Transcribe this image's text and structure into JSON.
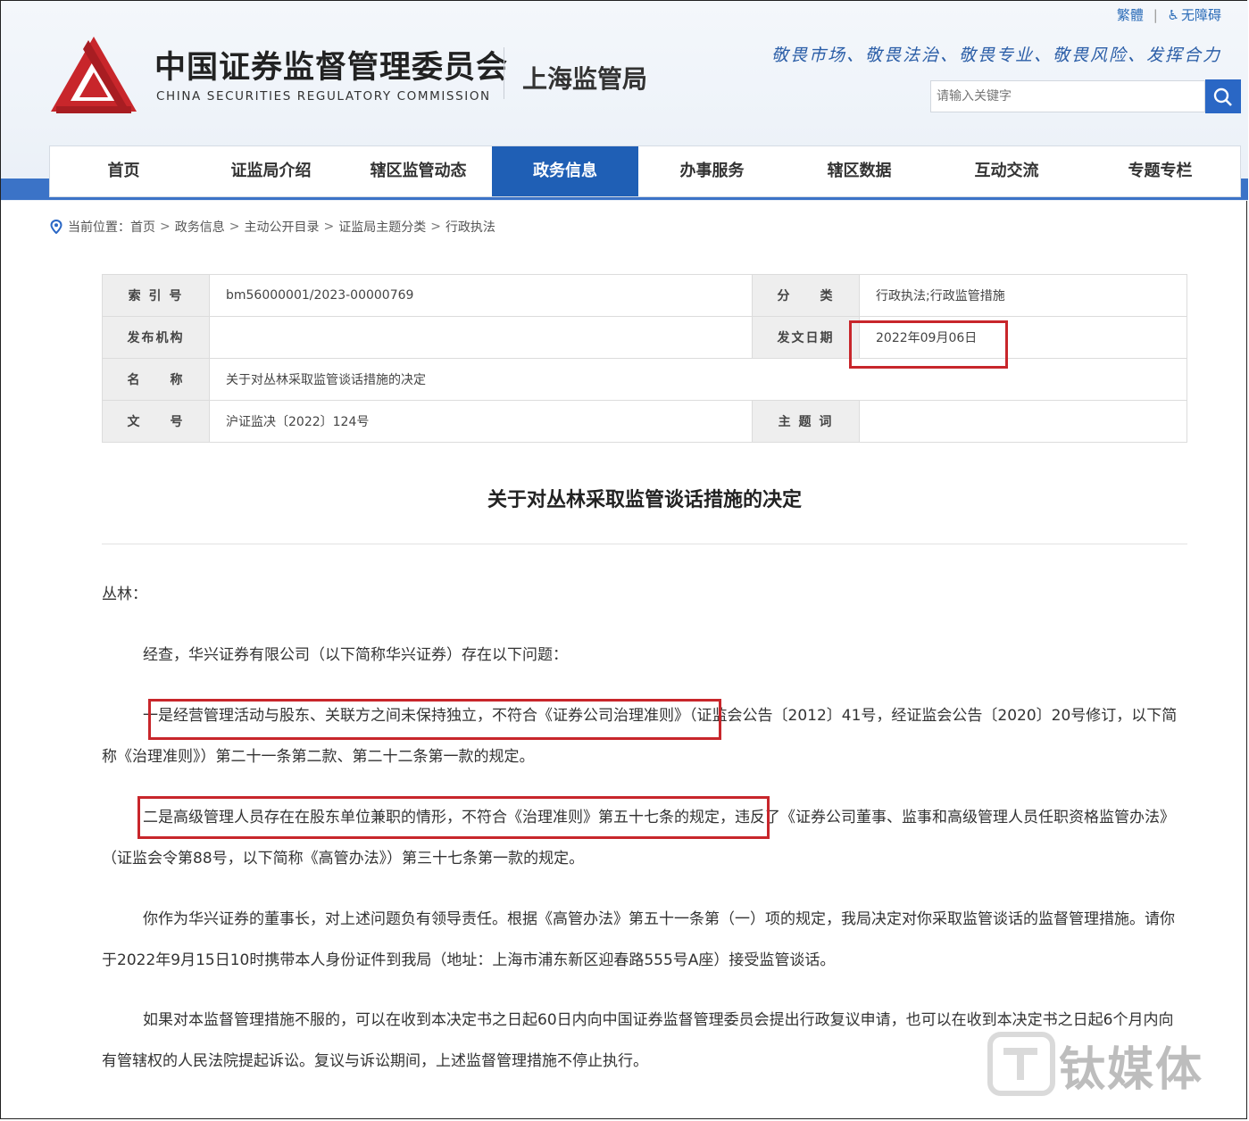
{
  "header": {
    "top_links": [
      "繁體",
      "|",
      "无障碍"
    ],
    "org_cn": "中国证券监督管理委员会",
    "org_en": "CHINA SECURITIES REGULATORY COMMISSION",
    "bureau": "上海监管局",
    "motto": "敬畏市场、敬畏法治、敬畏专业、敬畏风险、发挥合力",
    "search_placeholder": "请输入关键字",
    "brand_color": "#c8262b",
    "accent_color": "#1f5fb5"
  },
  "nav": {
    "items": [
      "首页",
      "证监局介绍",
      "辖区监管动态",
      "政务信息",
      "办事服务",
      "辖区数据",
      "互动交流",
      "专题专栏"
    ],
    "active": "政务信息"
  },
  "breadcrumb": {
    "prefix": "当前位置：",
    "items": [
      "首页",
      "政务信息",
      "主动公开目录",
      "证监局主题分类",
      "行政执法"
    ],
    "separator": ">"
  },
  "meta": {
    "index_label": "索 引 号",
    "index_value": "bm56000001/2023-00000769",
    "category_label": "分　　类",
    "category_value": "行政执法;行政监管措施",
    "publisher_label": "发布机构",
    "publisher_value": "",
    "date_label": "发文日期",
    "date_value": "2022年09月06日",
    "name_label": "名　　称",
    "name_value": "关于对丛林采取监管谈话措施的决定",
    "docno_label": "文　　号",
    "docno_value": "沪证监决〔2022〕124号",
    "keyword_label": "主 题 词",
    "keyword_value": ""
  },
  "document": {
    "title": "关于对丛林采取监管谈话措施的决定",
    "salutation": "丛林：",
    "p1": "经查，华兴证券有限公司（以下简称华兴证券）存在以下问题：",
    "p2": "一是经营管理活动与股东、关联方之间未保持独立，不符合《证券公司治理准则》（证监会公告〔2012〕41号，经证监会公告〔2020〕20号修订，以下简称《治理准则》）第二十一条第二款、第二十二条第一款的规定。",
    "p3": "二是高级管理人员存在在股东单位兼职的情形，不符合《治理准则》第五十七条的规定，违反了《证券公司董事、监事和高级管理人员任职资格监管办法》（证监会令第88号，以下简称《高管办法》）第三十七条第一款的规定。",
    "p4": "你作为华兴证券的董事长，对上述问题负有领导责任。根据《高管办法》第五十一条第（一）项的规定，我局决定对你采取监管谈话的监督管理措施。请你于2022年9月15日10时携带本人身份证件到我局（地址：上海市浦东新区迎春路555号A座）接受监管谈话。",
    "p5": "如果对本监督管理措施不服的，可以在收到本决定书之日起60日内向中国证券监督管理委员会提出行政复议申请，也可以在收到本决定书之日起6个月内向有管辖权的人民法院提起诉讼。复议与诉讼期间，上述监督管理措施不停止执行。"
  },
  "watermark": {
    "text": "钛媒体"
  }
}
